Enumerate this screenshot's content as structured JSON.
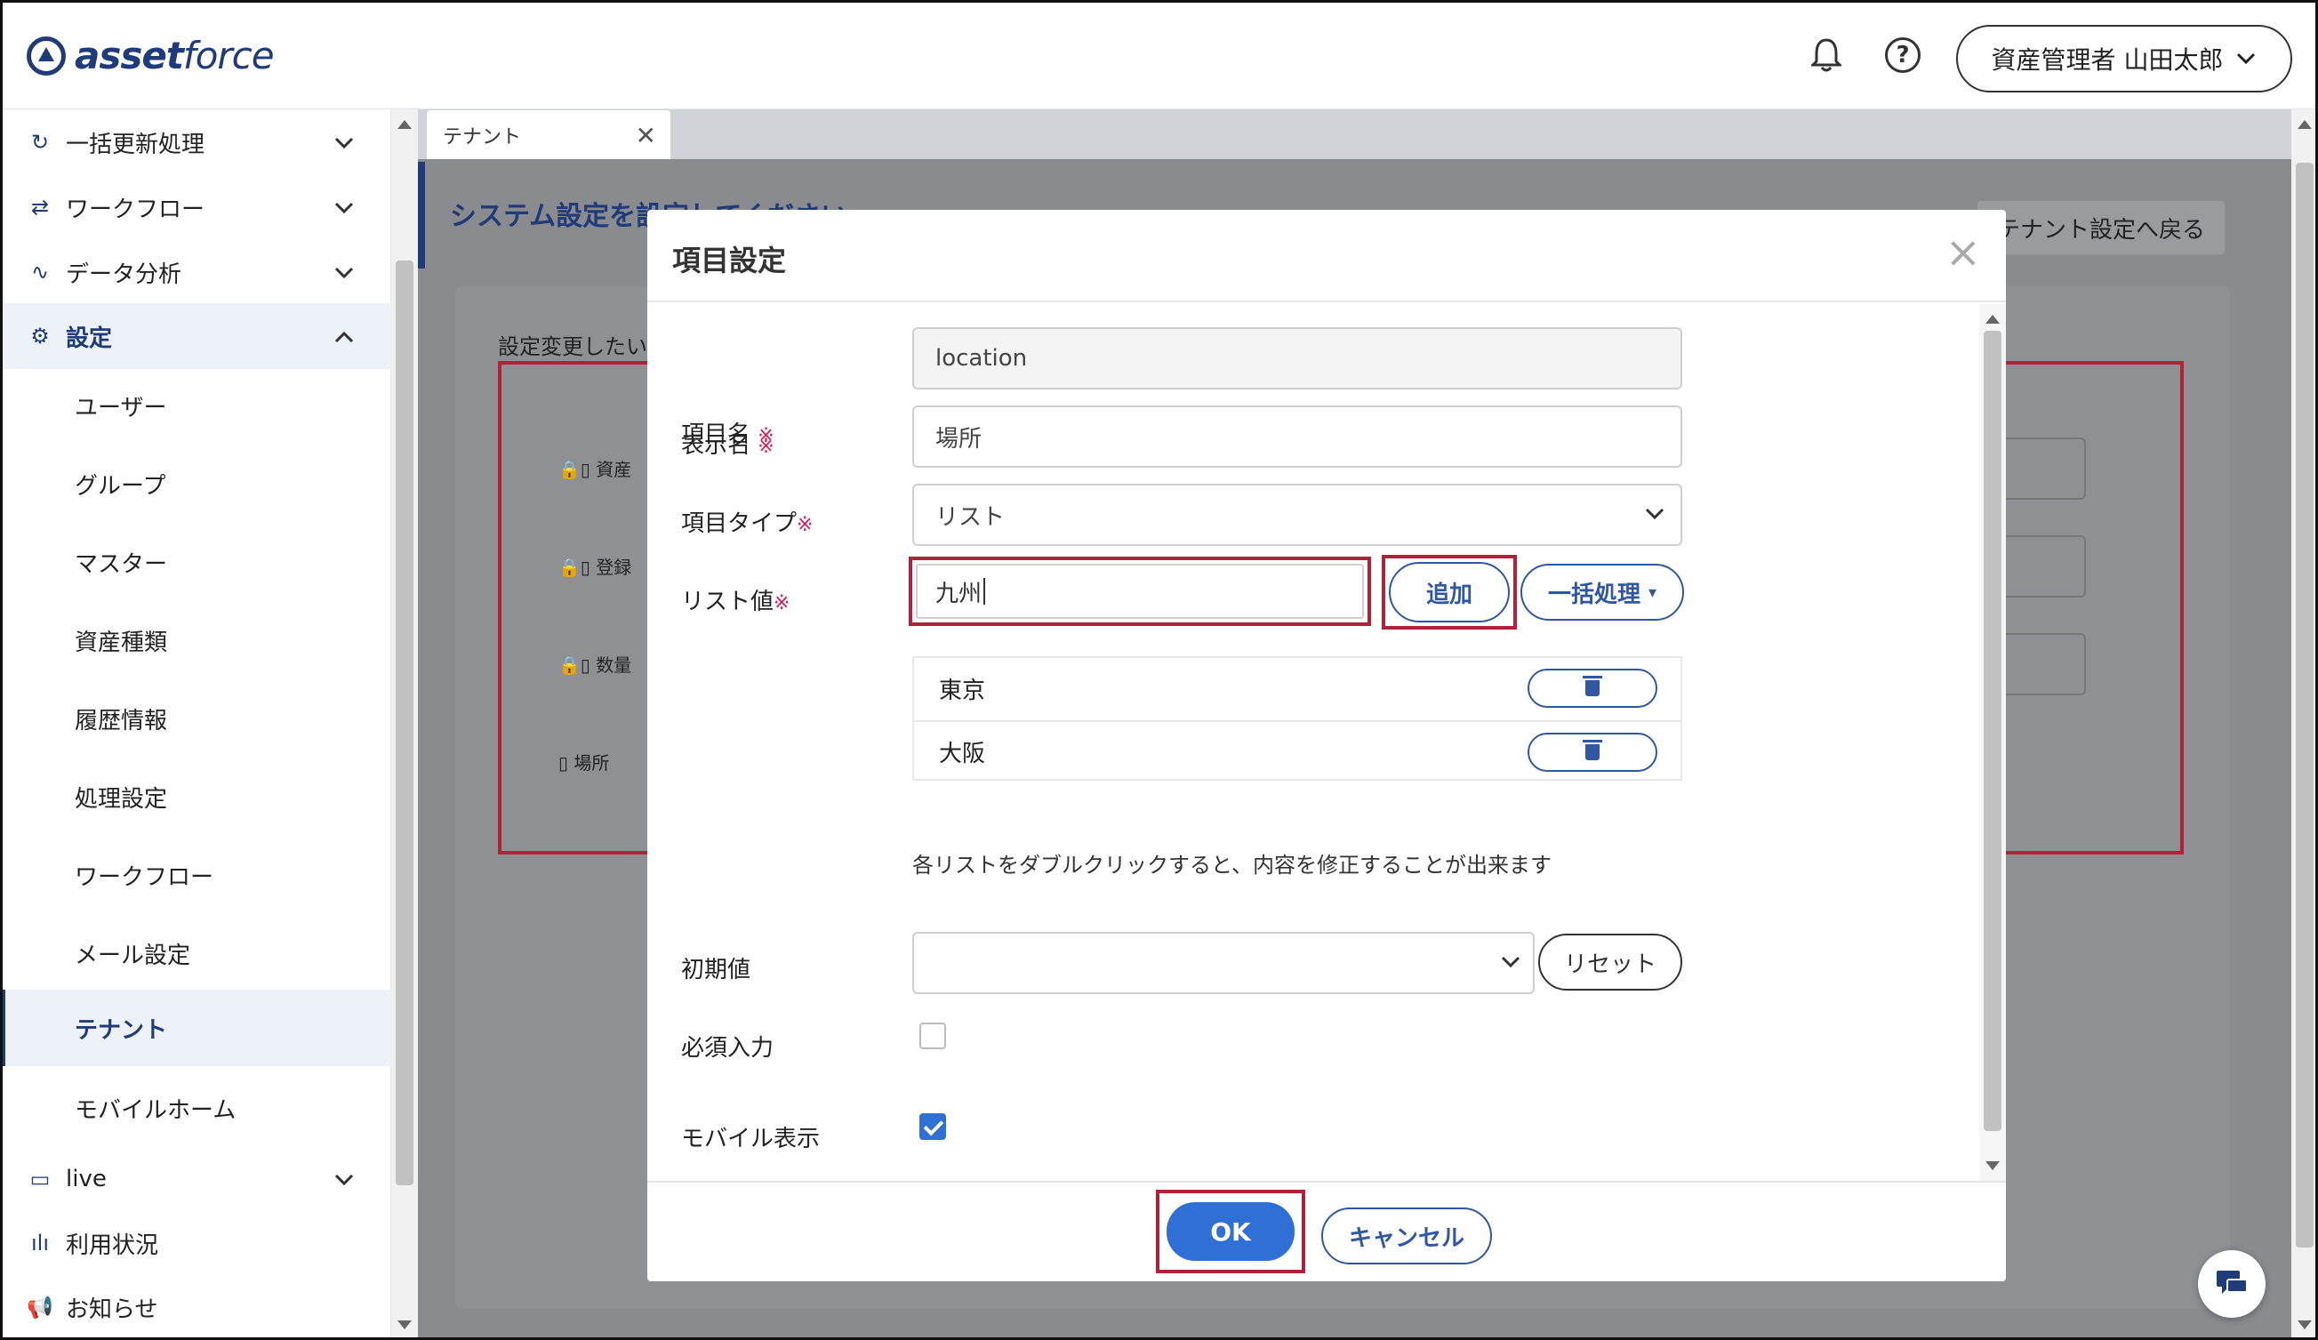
{
  "header": {
    "logo_bold": "asset",
    "logo_light": "force",
    "user_name": "資産管理者 山田太郎",
    "icons": [
      "bell-icon",
      "help-icon",
      "chevron-down-icon"
    ]
  },
  "sidebar": {
    "groups": [
      {
        "label": "一括更新処理",
        "icon": "refresh-icon"
      },
      {
        "label": "ワークフロー",
        "icon": "workflow-icon"
      },
      {
        "label": "データ分析",
        "icon": "analytics-icon"
      },
      {
        "label": "設定",
        "icon": "gear-icon"
      }
    ],
    "sub_items": [
      "ユーザー",
      "グループ",
      "マスター",
      "資産種類",
      "履歴情報",
      "処理設定",
      "ワークフロー",
      "メール設定",
      "テナント",
      "モバイルホーム"
    ],
    "bottom_items": [
      {
        "label": "live",
        "icon": "chat-icon"
      },
      {
        "label": "利用状況",
        "icon": "bar-chart-icon"
      },
      {
        "label": "お知らせ",
        "icon": "megaphone-icon"
      }
    ]
  },
  "tab": {
    "label": "テナント"
  },
  "background": {
    "page_title": "システム設定を設定してください",
    "back_button": "テナント設定へ戻る",
    "section_label": "設定変更したい",
    "rows": [
      "資産",
      "登録",
      "数量",
      "場所"
    ]
  },
  "modal": {
    "title": "項目設定",
    "fields": {
      "name_label": "項目名",
      "name_value": "location",
      "display_label": "表示名",
      "display_value": "場所",
      "type_label": "項目タイプ",
      "type_value": "リスト",
      "list_label": "リスト値",
      "list_input_value": "九州",
      "required_mark": "※"
    },
    "add_button": "追加",
    "bulk_button": "一括処理",
    "list_values": [
      "東京",
      "大阪"
    ],
    "hint": "各リストをダブルクリックすると、内容を修正することが出来ます",
    "initial_label": "初期値",
    "initial_value": "",
    "reset_button": "リセット",
    "required_input_label": "必須入力",
    "required_input_checked": false,
    "mobile_display_label": "モバイル表示",
    "mobile_display_checked": true,
    "ok_button": "OK",
    "cancel_button": "キャンセル"
  },
  "colors": {
    "brand": "#1f3b7a",
    "primary": "#2f6fd6",
    "highlight": "#b0213a",
    "required": "#d0205a"
  }
}
